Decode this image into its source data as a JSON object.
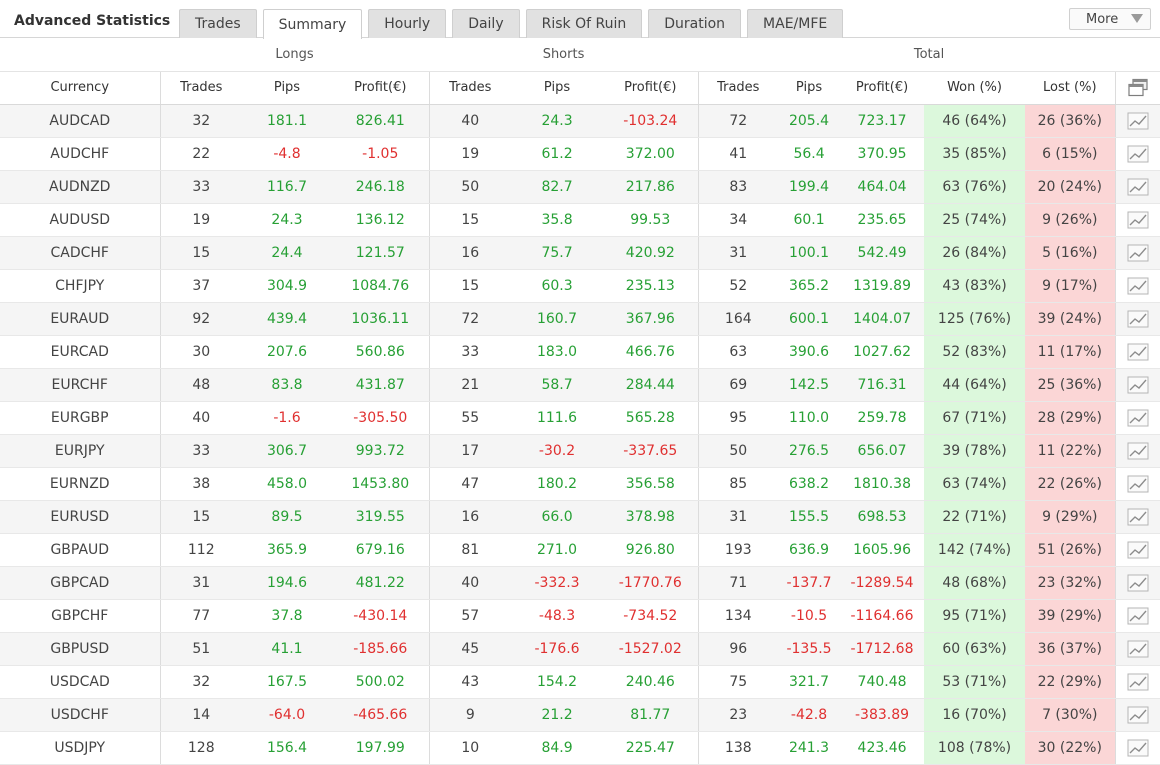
{
  "header": {
    "title": "Advanced Statistics",
    "tabs": [
      {
        "label": "Trades"
      },
      {
        "label": "Summary"
      },
      {
        "label": "Hourly"
      },
      {
        "label": "Daily"
      },
      {
        "label": "Risk Of Ruin"
      },
      {
        "label": "Duration"
      },
      {
        "label": "MAE/MFE"
      }
    ],
    "active_tab": "Summary",
    "more_label": "More"
  },
  "table": {
    "groups": {
      "longs": "Longs",
      "shorts": "Shorts",
      "total": "Total"
    },
    "columns": {
      "currency": "Currency",
      "trades": "Trades",
      "pips": "Pips",
      "profit": "Profit(€)",
      "won": "Won (%)",
      "lost": "Lost (%)"
    },
    "rows": [
      {
        "currency": "AUDCAD",
        "l_trades": "32",
        "l_pips": "181.1",
        "l_profit": "826.41",
        "s_trades": "40",
        "s_pips": "24.3",
        "s_profit": "-103.24",
        "t_trades": "72",
        "t_pips": "205.4",
        "t_profit": "723.17",
        "won": "46 (64%)",
        "lost": "26 (36%)"
      },
      {
        "currency": "AUDCHF",
        "l_trades": "22",
        "l_pips": "-4.8",
        "l_profit": "-1.05",
        "s_trades": "19",
        "s_pips": "61.2",
        "s_profit": "372.00",
        "t_trades": "41",
        "t_pips": "56.4",
        "t_profit": "370.95",
        "won": "35 (85%)",
        "lost": "6 (15%)"
      },
      {
        "currency": "AUDNZD",
        "l_trades": "33",
        "l_pips": "116.7",
        "l_profit": "246.18",
        "s_trades": "50",
        "s_pips": "82.7",
        "s_profit": "217.86",
        "t_trades": "83",
        "t_pips": "199.4",
        "t_profit": "464.04",
        "won": "63 (76%)",
        "lost": "20 (24%)"
      },
      {
        "currency": "AUDUSD",
        "l_trades": "19",
        "l_pips": "24.3",
        "l_profit": "136.12",
        "s_trades": "15",
        "s_pips": "35.8",
        "s_profit": "99.53",
        "t_trades": "34",
        "t_pips": "60.1",
        "t_profit": "235.65",
        "won": "25 (74%)",
        "lost": "9 (26%)"
      },
      {
        "currency": "CADCHF",
        "l_trades": "15",
        "l_pips": "24.4",
        "l_profit": "121.57",
        "s_trades": "16",
        "s_pips": "75.7",
        "s_profit": "420.92",
        "t_trades": "31",
        "t_pips": "100.1",
        "t_profit": "542.49",
        "won": "26 (84%)",
        "lost": "5 (16%)"
      },
      {
        "currency": "CHFJPY",
        "l_trades": "37",
        "l_pips": "304.9",
        "l_profit": "1084.76",
        "s_trades": "15",
        "s_pips": "60.3",
        "s_profit": "235.13",
        "t_trades": "52",
        "t_pips": "365.2",
        "t_profit": "1319.89",
        "won": "43 (83%)",
        "lost": "9 (17%)"
      },
      {
        "currency": "EURAUD",
        "l_trades": "92",
        "l_pips": "439.4",
        "l_profit": "1036.11",
        "s_trades": "72",
        "s_pips": "160.7",
        "s_profit": "367.96",
        "t_trades": "164",
        "t_pips": "600.1",
        "t_profit": "1404.07",
        "won": "125 (76%)",
        "lost": "39 (24%)"
      },
      {
        "currency": "EURCAD",
        "l_trades": "30",
        "l_pips": "207.6",
        "l_profit": "560.86",
        "s_trades": "33",
        "s_pips": "183.0",
        "s_profit": "466.76",
        "t_trades": "63",
        "t_pips": "390.6",
        "t_profit": "1027.62",
        "won": "52 (83%)",
        "lost": "11 (17%)"
      },
      {
        "currency": "EURCHF",
        "l_trades": "48",
        "l_pips": "83.8",
        "l_profit": "431.87",
        "s_trades": "21",
        "s_pips": "58.7",
        "s_profit": "284.44",
        "t_trades": "69",
        "t_pips": "142.5",
        "t_profit": "716.31",
        "won": "44 (64%)",
        "lost": "25 (36%)"
      },
      {
        "currency": "EURGBP",
        "l_trades": "40",
        "l_pips": "-1.6",
        "l_profit": "-305.50",
        "s_trades": "55",
        "s_pips": "111.6",
        "s_profit": "565.28",
        "t_trades": "95",
        "t_pips": "110.0",
        "t_profit": "259.78",
        "won": "67 (71%)",
        "lost": "28 (29%)"
      },
      {
        "currency": "EURJPY",
        "l_trades": "33",
        "l_pips": "306.7",
        "l_profit": "993.72",
        "s_trades": "17",
        "s_pips": "-30.2",
        "s_profit": "-337.65",
        "t_trades": "50",
        "t_pips": "276.5",
        "t_profit": "656.07",
        "won": "39 (78%)",
        "lost": "11 (22%)"
      },
      {
        "currency": "EURNZD",
        "l_trades": "38",
        "l_pips": "458.0",
        "l_profit": "1453.80",
        "s_trades": "47",
        "s_pips": "180.2",
        "s_profit": "356.58",
        "t_trades": "85",
        "t_pips": "638.2",
        "t_profit": "1810.38",
        "won": "63 (74%)",
        "lost": "22 (26%)"
      },
      {
        "currency": "EURUSD",
        "l_trades": "15",
        "l_pips": "89.5",
        "l_profit": "319.55",
        "s_trades": "16",
        "s_pips": "66.0",
        "s_profit": "378.98",
        "t_trades": "31",
        "t_pips": "155.5",
        "t_profit": "698.53",
        "won": "22 (71%)",
        "lost": "9 (29%)"
      },
      {
        "currency": "GBPAUD",
        "l_trades": "112",
        "l_pips": "365.9",
        "l_profit": "679.16",
        "s_trades": "81",
        "s_pips": "271.0",
        "s_profit": "926.80",
        "t_trades": "193",
        "t_pips": "636.9",
        "t_profit": "1605.96",
        "won": "142 (74%)",
        "lost": "51 (26%)"
      },
      {
        "currency": "GBPCAD",
        "l_trades": "31",
        "l_pips": "194.6",
        "l_profit": "481.22",
        "s_trades": "40",
        "s_pips": "-332.3",
        "s_profit": "-1770.76",
        "t_trades": "71",
        "t_pips": "-137.7",
        "t_profit": "-1289.54",
        "won": "48 (68%)",
        "lost": "23 (32%)"
      },
      {
        "currency": "GBPCHF",
        "l_trades": "77",
        "l_pips": "37.8",
        "l_profit": "-430.14",
        "s_trades": "57",
        "s_pips": "-48.3",
        "s_profit": "-734.52",
        "t_trades": "134",
        "t_pips": "-10.5",
        "t_profit": "-1164.66",
        "won": "95 (71%)",
        "lost": "39 (29%)"
      },
      {
        "currency": "GBPUSD",
        "l_trades": "51",
        "l_pips": "41.1",
        "l_profit": "-185.66",
        "s_trades": "45",
        "s_pips": "-176.6",
        "s_profit": "-1527.02",
        "t_trades": "96",
        "t_pips": "-135.5",
        "t_profit": "-1712.68",
        "won": "60 (63%)",
        "lost": "36 (37%)"
      },
      {
        "currency": "USDCAD",
        "l_trades": "32",
        "l_pips": "167.5",
        "l_profit": "500.02",
        "s_trades": "43",
        "s_pips": "154.2",
        "s_profit": "240.46",
        "t_trades": "75",
        "t_pips": "321.7",
        "t_profit": "740.48",
        "won": "53 (71%)",
        "lost": "22 (29%)"
      },
      {
        "currency": "USDCHF",
        "l_trades": "14",
        "l_pips": "-64.0",
        "l_profit": "-465.66",
        "s_trades": "9",
        "s_pips": "21.2",
        "s_profit": "81.77",
        "t_trades": "23",
        "t_pips": "-42.8",
        "t_profit": "-383.89",
        "won": "16 (70%)",
        "lost": "7 (30%)"
      },
      {
        "currency": "USDJPY",
        "l_trades": "128",
        "l_pips": "156.4",
        "l_profit": "197.99",
        "s_trades": "10",
        "s_pips": "84.9",
        "s_profit": "225.47",
        "t_trades": "138",
        "t_pips": "241.3",
        "t_profit": "423.46",
        "won": "108 (78%)",
        "lost": "30 (22%)"
      }
    ]
  },
  "icons": {
    "row_action": "line-chart-icon",
    "header_action": "multi-window-icon"
  },
  "colors": {
    "positive": "#27a035",
    "negative": "#e03030",
    "won_bg": "#dcf8dc",
    "lost_bg": "#fbd6d6"
  }
}
